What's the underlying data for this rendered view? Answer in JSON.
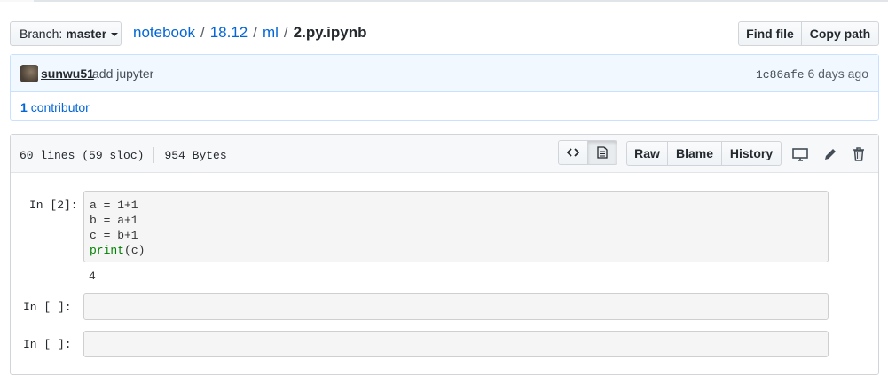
{
  "branch": {
    "label": "Branch:",
    "name": "master"
  },
  "breadcrumb": {
    "repo": "notebook",
    "parts": [
      "18.12",
      "ml"
    ],
    "file": "2.py.ipynb",
    "separator": "/"
  },
  "file_actions": {
    "find_file": "Find file",
    "copy_path": "Copy path"
  },
  "commit": {
    "author": "sunwu51",
    "message": "add jupyter",
    "sha": "1c86afe",
    "age": "6 days ago"
  },
  "contributors": {
    "count": "1",
    "label": "contributor"
  },
  "file_info": {
    "lines": "60 lines (59 sloc)",
    "size": "954 Bytes"
  },
  "toolbar": {
    "raw": "Raw",
    "blame": "Blame",
    "history": "History",
    "icons": [
      "code-icon",
      "file-text-icon",
      "desktop-icon",
      "pencil-icon",
      "trash-icon"
    ]
  },
  "notebook": {
    "cells": [
      {
        "prompt": "In  [2]:",
        "code": [
          "a = 1+1",
          "b = a+1",
          "c = b+1"
        ],
        "call_fn": "print",
        "call_args": "(c)",
        "output": "4"
      },
      {
        "prompt": "In  [ ]:",
        "code": []
      },
      {
        "prompt": "In  [ ]:",
        "code": []
      }
    ]
  },
  "colors": {
    "link": "#0366d6",
    "commit_bg": "#f1f8ff",
    "commit_border": "#c8e1ff",
    "code_builtin": "#008000"
  }
}
